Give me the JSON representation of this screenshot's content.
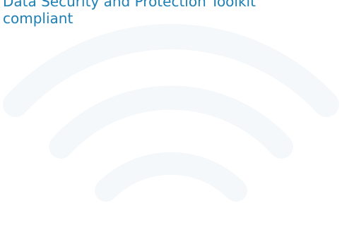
{
  "headline": {
    "line1": "Data Security and Protection Toolkit",
    "line2": "compliant"
  },
  "graphic": {
    "icon": "wifi-icon"
  },
  "colors": {
    "headline_text": "#1c7fb5",
    "wifi_arc": "#f4f8fa",
    "background": "#ffffff"
  }
}
